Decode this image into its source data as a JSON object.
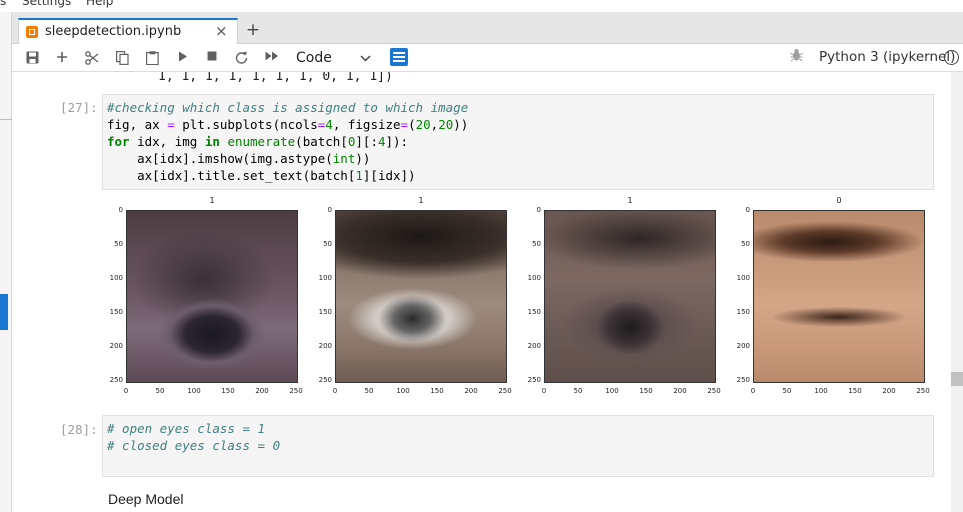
{
  "menubar": {
    "items": [
      "s",
      "Settings",
      "Help"
    ]
  },
  "tab": {
    "title": "sleepdetection.ipynb",
    "close": "×",
    "new": "+"
  },
  "toolbar": {
    "cell_type": "Code",
    "kernel": "Python 3 (ipykernel)",
    "icons": [
      "save-icon",
      "add-cell-icon",
      "cut-icon",
      "copy-icon",
      "paste-icon",
      "run-icon",
      "stop-icon",
      "restart-icon",
      "fast-forward-icon",
      "chevron-down-icon",
      "property-inspector-icon",
      "debugger-icon",
      "kernel-status-icon"
    ]
  },
  "previous_output": "1, 1, 1, 1, 1, 1, 1, 0, 1, 1])",
  "cells": [
    {
      "prompt": "[27]:",
      "lines": [
        [
          {
            "t": "#checking which class is assigned to which image",
            "c": "cm"
          }
        ],
        [
          {
            "t": "fig, ax "
          },
          {
            "t": "=",
            "c": "op"
          },
          {
            "t": " plt.subplots(ncols"
          },
          {
            "t": "=",
            "c": "op"
          },
          {
            "t": "4",
            "c": "num"
          },
          {
            "t": ", figsize"
          },
          {
            "t": "=",
            "c": "op"
          },
          {
            "t": "("
          },
          {
            "t": "20",
            "c": "num"
          },
          {
            "t": ","
          },
          {
            "t": "20",
            "c": "num"
          },
          {
            "t": "))"
          }
        ],
        [
          {
            "t": "for",
            "c": "kw"
          },
          {
            "t": " idx, img "
          },
          {
            "t": "in",
            "c": "kw"
          },
          {
            "t": " "
          },
          {
            "t": "enumerate",
            "c": "bi"
          },
          {
            "t": "(batch["
          },
          {
            "t": "0",
            "c": "num"
          },
          {
            "t": "][:"
          },
          {
            "t": "4",
            "c": "num"
          },
          {
            "t": "]):"
          }
        ],
        [
          {
            "t": "    ax[idx].imshow(img.astype("
          },
          {
            "t": "int",
            "c": "bi"
          },
          {
            "t": "))"
          }
        ],
        [
          {
            "t": "    ax[idx].title.set_text(batch["
          },
          {
            "t": "1",
            "c": "num"
          },
          {
            "t": "][idx])"
          }
        ]
      ]
    },
    {
      "prompt": "[28]:",
      "lines": [
        [
          {
            "t": "# open eyes class = 1",
            "c": "cm"
          }
        ],
        [
          {
            "t": "# closed eyes class = 0",
            "c": "cm"
          }
        ]
      ]
    }
  ],
  "figure": {
    "subplots": [
      {
        "title": "1",
        "image": "open eye, dark lighting"
      },
      {
        "title": "1",
        "image": "open eye, bright"
      },
      {
        "title": "1",
        "image": "open eye, half lidded"
      },
      {
        "title": "0",
        "image": "closed eye"
      }
    ],
    "yticks": [
      "0",
      "50",
      "100",
      "150",
      "200",
      "250"
    ],
    "xticks": [
      "0",
      "50",
      "100",
      "150",
      "200",
      "250"
    ]
  },
  "markdown": {
    "heading": "Deep Model"
  }
}
